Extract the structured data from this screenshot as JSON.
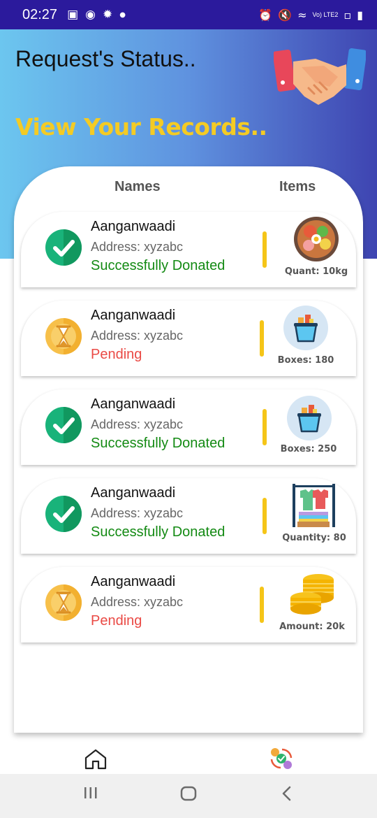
{
  "status_bar": {
    "time": "02:27",
    "network_label": "Vo) LTE2"
  },
  "header": {
    "title": "Request's Status..",
    "subtitle": "View Your Records..",
    "illustration": "handshake-icon"
  },
  "columns": {
    "names": "Names",
    "items": "Items"
  },
  "records": [
    {
      "name": "Aanganwaadi",
      "address": "Address: xyzabc",
      "status": "Successfully Donated",
      "status_type": "success",
      "item_icon": "food-bowl-icon",
      "item_label": "Quant: 10kg"
    },
    {
      "name": "Aanganwaadi",
      "address": "Address: xyzabc",
      "status": "Pending",
      "status_type": "pending",
      "item_icon": "box-icon",
      "item_label": "Boxes: 180"
    },
    {
      "name": "Aanganwaadi",
      "address": "Address: xyzabc",
      "status": "Successfully Donated",
      "status_type": "success",
      "item_icon": "box-icon",
      "item_label": "Boxes: 250"
    },
    {
      "name": "Aanganwaadi",
      "address": "Address: xyzabc",
      "status": "Successfully Donated",
      "status_type": "success",
      "item_icon": "clothes-rack-icon",
      "item_label": "Quantity: 80"
    },
    {
      "name": "Aanganwaadi",
      "address": "Address: xyzabc",
      "status": "Pending",
      "status_type": "pending",
      "item_icon": "coins-icon",
      "item_label": "Amount: 20k"
    }
  ],
  "bottom_nav": {
    "home": "home-icon",
    "status": "request-status-icon"
  },
  "colors": {
    "accent_yellow": "#f4cb24",
    "success_green": "#138a13",
    "pending_red": "#ea4a45",
    "status_bar": "#2b1a9c"
  }
}
